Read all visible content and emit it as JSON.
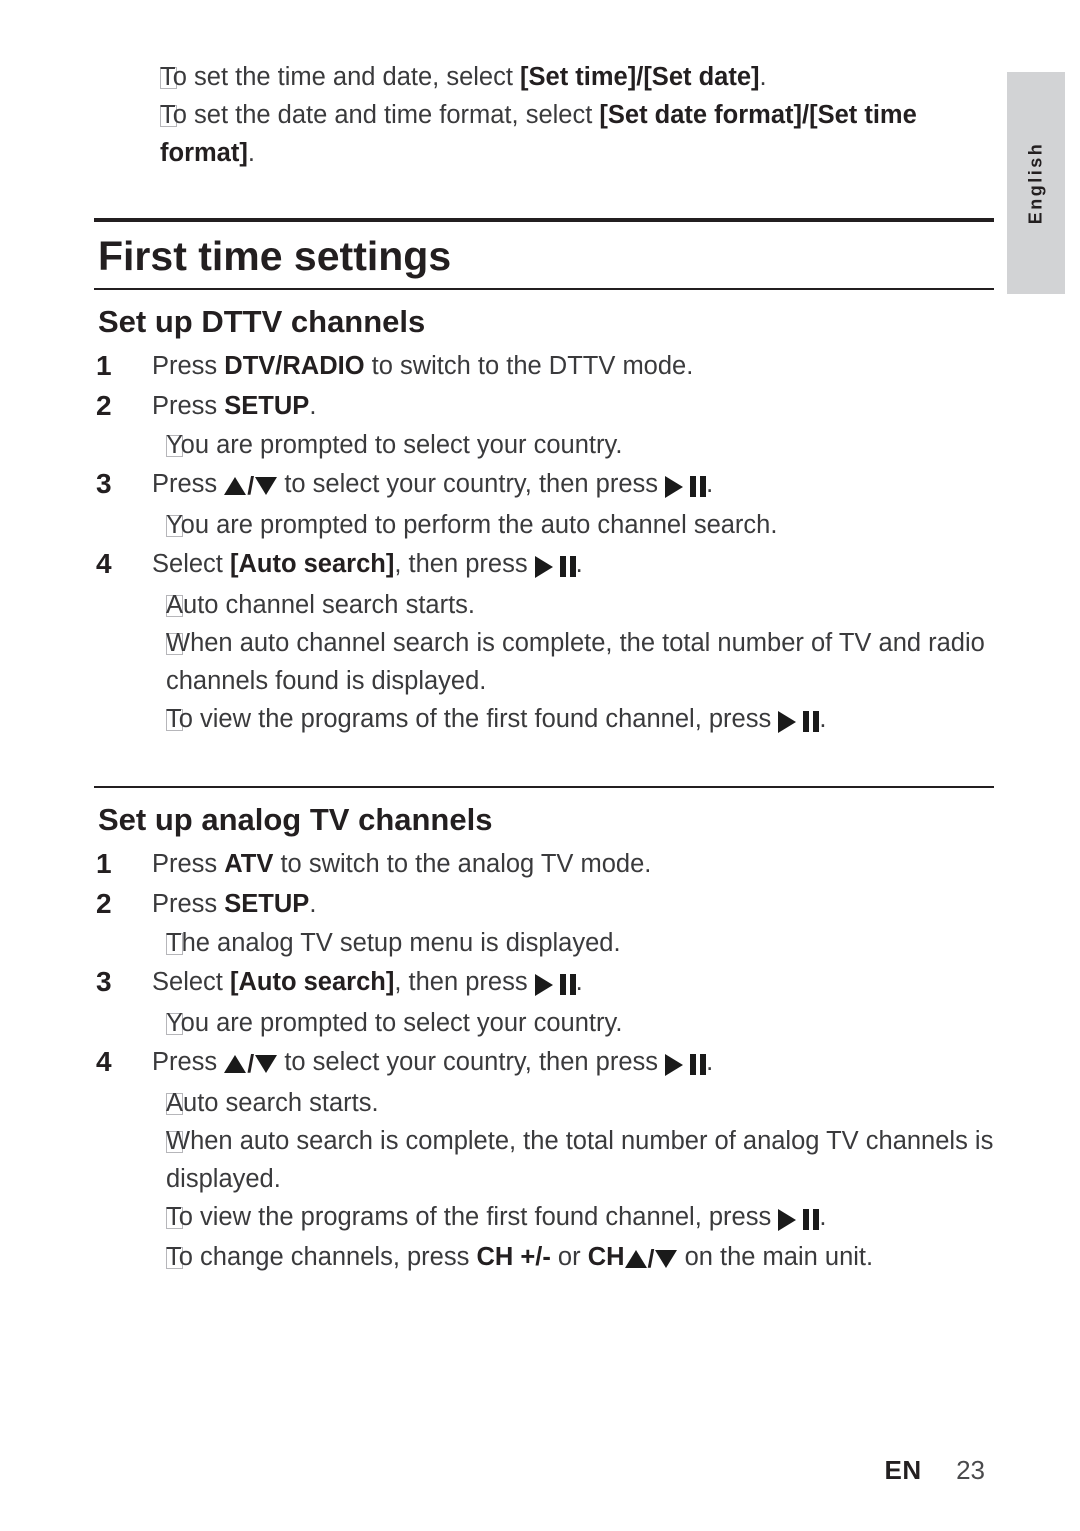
{
  "page": {
    "language_tab": "English",
    "footer": {
      "locale_code": "EN",
      "page_number": "23"
    }
  },
  "intro_bullets": [
    {
      "prefix": "To set the time and date, select ",
      "bold": "[Set time]/[Set date]",
      "suffix": "."
    },
    {
      "prefix": "To set the date and time format, select ",
      "bold": "[Set date format]/[Set time format]",
      "suffix": "."
    }
  ],
  "section_title": "First time settings",
  "sections": [
    {
      "heading": "Set up DTTV channels",
      "steps": [
        {
          "number": "1",
          "text_parts": [
            {
              "t": "Press ",
              "style": "normal"
            },
            {
              "t": "DTV/RADIO",
              "style": "bold"
            },
            {
              "t": " to switch to the DTTV mode.",
              "style": "normal"
            }
          ],
          "bullets": []
        },
        {
          "number": "2",
          "text_parts": [
            {
              "t": "Press ",
              "style": "normal"
            },
            {
              "t": "SETUP",
              "style": "bold"
            },
            {
              "t": ".",
              "style": "normal"
            }
          ],
          "bullets": [
            [
              {
                "t": "You are prompted to select your country.",
                "style": "normal"
              }
            ]
          ]
        },
        {
          "number": "3",
          "text_parts": [
            {
              "t": "Press ",
              "style": "normal"
            },
            {
              "t": "",
              "style": "updown-icon"
            },
            {
              "t": " to select your country, then press ",
              "style": "normal"
            },
            {
              "t": "",
              "style": "playpause-icon"
            },
            {
              "t": ".",
              "style": "normal"
            }
          ],
          "bullets": [
            [
              {
                "t": "You are prompted to perform the auto channel search.",
                "style": "normal"
              }
            ]
          ]
        },
        {
          "number": "4",
          "text_parts": [
            {
              "t": "Select ",
              "style": "normal"
            },
            {
              "t": "[Auto search]",
              "style": "bold"
            },
            {
              "t": ", then press ",
              "style": "normal"
            },
            {
              "t": "",
              "style": "playpause-icon"
            },
            {
              "t": ".",
              "style": "normal"
            }
          ],
          "bullets": [
            [
              {
                "t": "Auto channel search starts.",
                "style": "normal"
              }
            ],
            [
              {
                "t": "When auto channel search is complete, the total number of TV and radio channels found is displayed.",
                "style": "normal"
              }
            ],
            [
              {
                "t": "To view the programs of the first found channel, press ",
                "style": "normal"
              },
              {
                "t": "",
                "style": "playpause-icon"
              },
              {
                "t": ".",
                "style": "normal"
              }
            ]
          ]
        }
      ]
    },
    {
      "heading": "Set up analog TV channels",
      "steps": [
        {
          "number": "1",
          "text_parts": [
            {
              "t": "Press ",
              "style": "normal"
            },
            {
              "t": "ATV",
              "style": "bold"
            },
            {
              "t": " to switch to the analog TV mode.",
              "style": "normal"
            }
          ],
          "bullets": []
        },
        {
          "number": "2",
          "text_parts": [
            {
              "t": "Press ",
              "style": "normal"
            },
            {
              "t": "SETUP",
              "style": "bold"
            },
            {
              "t": ".",
              "style": "normal"
            }
          ],
          "bullets": [
            [
              {
                "t": "The analog TV setup menu is displayed.",
                "style": "normal"
              }
            ]
          ]
        },
        {
          "number": "3",
          "text_parts": [
            {
              "t": "Select ",
              "style": "normal"
            },
            {
              "t": "[Auto search]",
              "style": "bold"
            },
            {
              "t": ", then press ",
              "style": "normal"
            },
            {
              "t": "",
              "style": "playpause-icon"
            },
            {
              "t": ".",
              "style": "normal"
            }
          ],
          "bullets": [
            [
              {
                "t": "You are prompted to select your country.",
                "style": "normal"
              }
            ]
          ]
        },
        {
          "number": "4",
          "text_parts": [
            {
              "t": "Press ",
              "style": "normal"
            },
            {
              "t": "",
              "style": "updown-icon"
            },
            {
              "t": " to select your country, then press ",
              "style": "normal"
            },
            {
              "t": "",
              "style": "playpause-icon"
            },
            {
              "t": ".",
              "style": "normal"
            }
          ],
          "bullets": [
            [
              {
                "t": "Auto search starts.",
                "style": "normal"
              }
            ],
            [
              {
                "t": "When auto search is complete, the total number of analog TV channels is displayed.",
                "style": "normal"
              }
            ],
            [
              {
                "t": "To view the programs of the first found channel, press ",
                "style": "normal"
              },
              {
                "t": "",
                "style": "playpause-icon"
              },
              {
                "t": ".",
                "style": "normal"
              }
            ],
            [
              {
                "t": "To change channels, press ",
                "style": "normal"
              },
              {
                "t": "CH +/-",
                "style": "bold"
              },
              {
                "t": " or ",
                "style": "normal"
              },
              {
                "t": "CH",
                "style": "bold"
              },
              {
                "t": "",
                "style": "updown-icon"
              },
              {
                "t": " on the main unit.",
                "style": "normal"
              }
            ]
          ]
        }
      ]
    }
  ]
}
